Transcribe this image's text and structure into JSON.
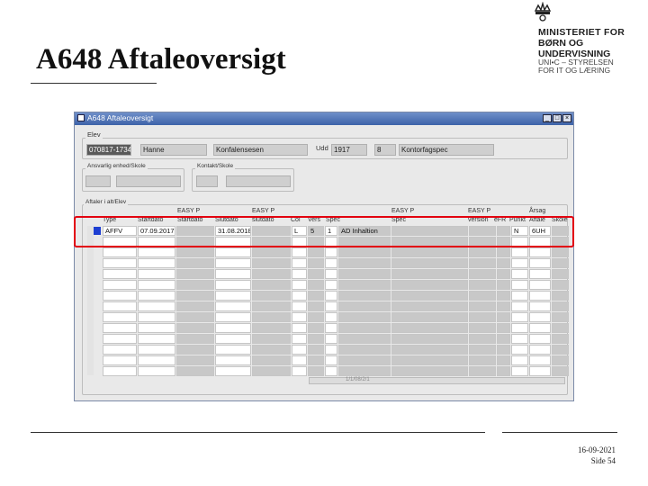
{
  "slide": {
    "title": "A648 Aftaleoversigt"
  },
  "logo": {
    "line1": "MINISTERIET FOR",
    "line2": "BØRN OG",
    "line3": "UNDERVISNING",
    "line4": "UNI•C – STYRELSEN",
    "line5": "FOR IT OG LÆRING"
  },
  "window": {
    "title": "A648 Aftaleoversigt",
    "elev": {
      "legend": "Elev",
      "cpr": "070817-1734",
      "name": "Hanne",
      "fullname": "Konfalensesen",
      "udd_label": "Udd",
      "udd_code": "1917",
      "udd_num": "8",
      "udd_name": "Kontorfagspec"
    },
    "ansvarlig_legend": "Ansvarlig enhed/Skole",
    "kontakt_legend": "Kontakt/Skole",
    "aftaler_legend": "Aftaler i alt/Elev",
    "columns": {
      "type": "Type",
      "startdato1": "Startdato",
      "easy_startdato_1": "EASY P",
      "easy_startdato_2": "Startdato",
      "slutdato": "Slutdato",
      "easy_slutdato_1": "EASY P",
      "easy_slutdato_2": "slutdato",
      "col": "Col",
      "vers": "Vers",
      "spec": "Spec",
      "easy_spec_1": "EASY P",
      "easy_spec_2": "Spec",
      "easy_version_1": "EASY P",
      "easy_version_2": "version",
      "efr": "eFR",
      "punkt": "Punkt",
      "aarsag_1": "Årsag",
      "aarsag_2": "Aftale",
      "skole": "Skole"
    },
    "row1": {
      "type": "AFFV",
      "startdato": "07.09.2017",
      "slutdato": "31.08.2018",
      "col": "L",
      "vers": "5",
      "spec": "1",
      "spec_name": "AD Inhaltion",
      "punkt": "N",
      "aarsag": "6UH"
    },
    "scroll_text": "1/1/08/2/1"
  },
  "footer": {
    "date": "16-09-2021",
    "page": "Side 54"
  },
  "colors": {
    "accent_red": "#e3000f",
    "title_blue": "#3d62a8",
    "selected_blue": "#1e3fd2"
  }
}
